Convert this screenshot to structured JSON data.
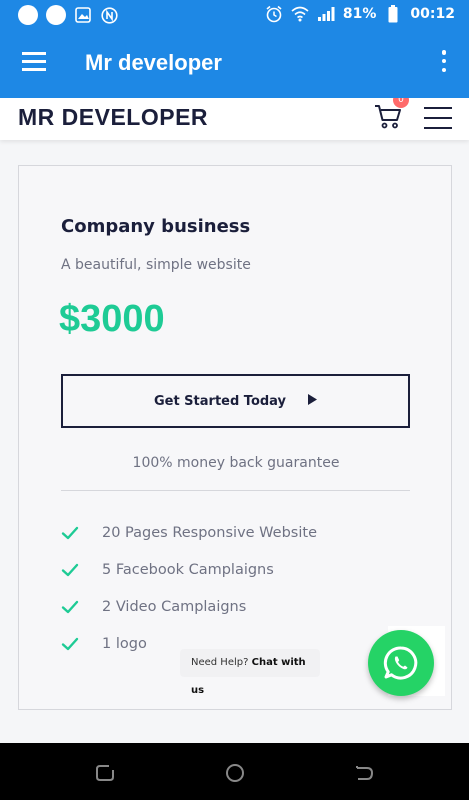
{
  "status_bar": {
    "battery": "81%",
    "time": "00:12",
    "icons": [
      "circle-notification-icon",
      "circle-notification-icon",
      "image-icon",
      "n-icon",
      "alarm-icon",
      "wifi-icon",
      "signal-icon",
      "battery-icon"
    ]
  },
  "app_bar": {
    "title": "Mr developer",
    "menu_icon": "hamburger-icon",
    "overflow_icon": "more-vert-icon"
  },
  "site_header": {
    "brand": "MR DEVELOPER",
    "cart_count": "0",
    "cart_icon": "cart-icon",
    "menu_icon": "hamburger-icon"
  },
  "pricing_card": {
    "plan_name": "Company business",
    "description": "A beautiful, simple website",
    "price": "$3000",
    "cta_label": "Get Started Today",
    "guarantee": "100% money back guarantee",
    "features": [
      "20 Pages Responsive Website",
      "5 Facebook Camplaigns",
      "2 Video Camplaigns",
      "1 logo"
    ]
  },
  "chat_widget": {
    "prompt": "Need Help?",
    "action": "Chat with us",
    "icon": "whatsapp-icon"
  },
  "nav_bar": {
    "icons": [
      "recent-apps-icon",
      "home-icon",
      "back-icon"
    ]
  },
  "colors": {
    "app_blue": "#1e88e5",
    "price_green": "#1ecb95",
    "whatsapp_green": "#25d366",
    "badge_red": "#ff6b6b",
    "navy": "#1b1f3b"
  }
}
